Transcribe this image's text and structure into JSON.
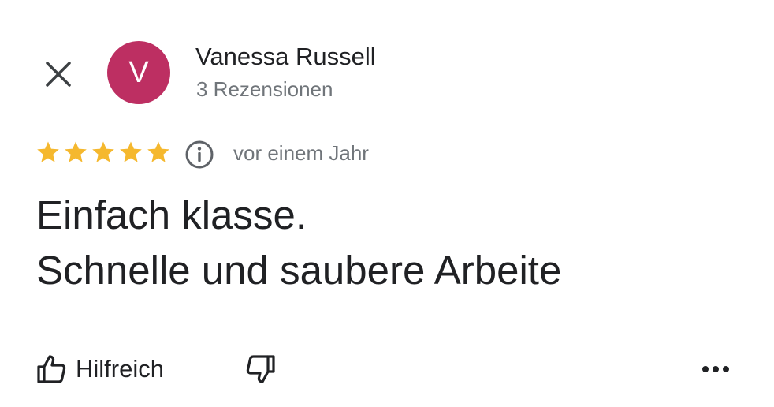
{
  "header": {
    "close_icon": "close-icon",
    "avatar": {
      "initial": "V",
      "background_color": "#bd2f62"
    },
    "author_name": "Vanessa Russell",
    "review_count": "3 Rezensionen"
  },
  "rating": {
    "stars": 5,
    "max_stars": 5,
    "star_color": "#f5b82e",
    "info_icon": "info-icon",
    "date": "vor einem Jahr"
  },
  "review": {
    "lines": [
      "Einfach klasse.",
      "Schnelle und saubere Arbeite"
    ]
  },
  "actions": {
    "helpful_label": "Hilfreich",
    "helpful_icon": "thumb-up-icon",
    "not_helpful_icon": "thumb-down-icon",
    "more_icon": "more-horizontal-icon"
  }
}
